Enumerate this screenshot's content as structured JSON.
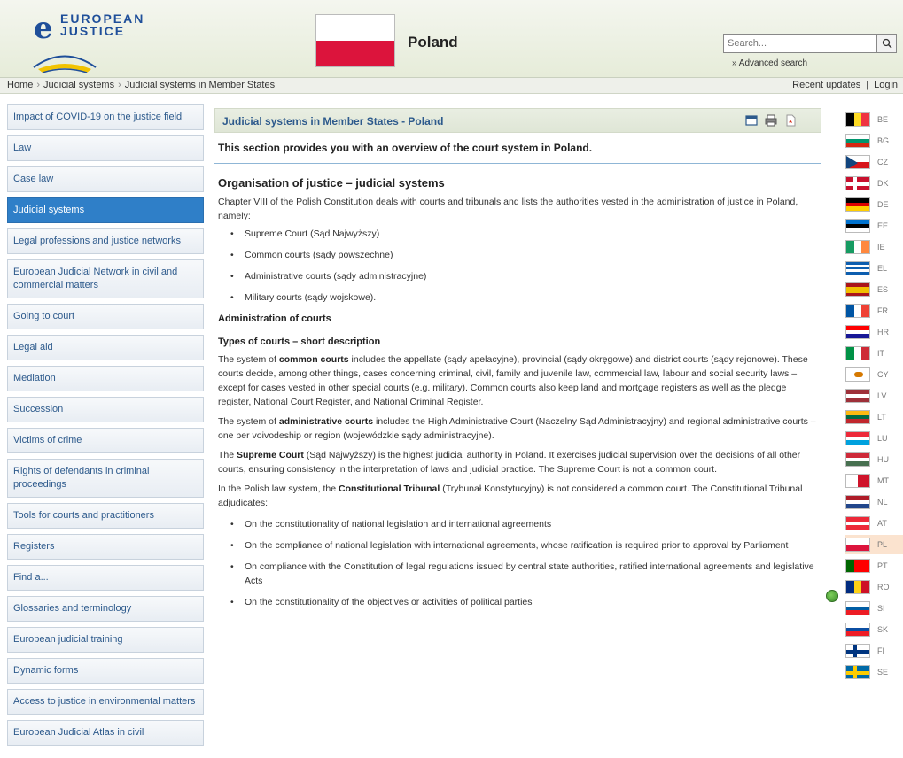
{
  "header": {
    "logo_line1": "EUROPEAN",
    "logo_line2": "JUSTICE",
    "country": "Poland",
    "search_placeholder": "Search...",
    "advanced_search": "» Advanced search"
  },
  "breadcrumb": {
    "items": [
      "Home",
      "Judicial systems",
      "Judicial systems in Member States"
    ],
    "recent_updates": "Recent updates",
    "separator": "|",
    "login": "Login"
  },
  "sidebar": {
    "items": [
      "Impact of COVID-19 on the justice field",
      "Law",
      "Case law",
      "Judicial systems",
      "Legal professions and justice networks",
      "European Judicial Network in civil and commercial matters",
      "Going to court",
      "Legal aid",
      "Mediation",
      "Succession",
      "Victims of crime",
      "Rights of defendants in criminal proceedings",
      "Tools for courts and practitioners",
      "Registers",
      "Find a...",
      "Glossaries and terminology",
      "European judicial training",
      "Dynamic forms",
      "Access to justice in environmental matters",
      "European Judicial Atlas in civil"
    ],
    "active_index": 3
  },
  "content": {
    "title": "Judicial systems in Member States - Poland",
    "intro": "This section provides you with an overview of the court system in Poland.",
    "heading": "Organisation of justice – judicial systems",
    "p1": "Chapter VIII of the Polish Constitution deals with courts and tribunals and lists the authorities vested in the administration of justice in Poland, namely:",
    "list1": [
      "Supreme Court (Sąd Najwyższy)",
      "Common courts (sądy powszechne)",
      "Administrative courts (sądy administracyjne)",
      "Military courts (sądy wojskowe)."
    ],
    "h_admin": "Administration of courts",
    "h_types": "Types of courts – short description",
    "p2_a": "The system of ",
    "p2_b": "common courts",
    "p2_c": " includes the appellate (sądy apelacyjne), provincial (sądy okręgowe) and district courts (sądy rejonowe). These courts decide, among other things, cases concerning criminal, civil, family and juvenile law, commercial law, labour and social security laws – except for cases vested in other special courts (e.g. military). Common courts also keep land and mortgage registers as well as the pledge register, National Court Register, and National Criminal Register.",
    "p3_a": "The system of ",
    "p3_b": "administrative courts",
    "p3_c": " includes the High Administrative Court (Naczelny Sąd Administracyjny) and regional administrative courts – one per voivodeship or region (wojewódzkie sądy administracyjne).",
    "p4_a": "The ",
    "p4_b": "Supreme Court",
    "p4_c": " (Sąd Najwyższy) is the highest judicial authority in Poland. It exercises judicial supervision over the decisions of all other courts, ensuring consistency in the interpretation of laws and judicial practice. The Supreme Court is not a common court.",
    "p5_a": "In the Polish law system, the ",
    "p5_b": "Constitutional Tribunal",
    "p5_c": " (Trybunał Konstytucyjny) is not considered a common court. The Constitutional Tribunal adjudicates:",
    "list2": [
      "On the constitutionality of national legislation and international agreements",
      "On the compliance of national legislation with international agreements, whose ratification is required prior to approval by Parliament",
      "On compliance with the Constitution of legal regulations issued by central state authorities, ratified international agreements and legislative Acts",
      "On the constitutionality of the objectives or activities of political parties"
    ]
  },
  "flags": [
    {
      "code": "BE",
      "dir": "v",
      "colors": [
        "#000000",
        "#fdda24",
        "#ef3340"
      ]
    },
    {
      "code": "BG",
      "dir": "h",
      "colors": [
        "#ffffff",
        "#00966e",
        "#d62612"
      ]
    },
    {
      "code": "CZ",
      "dir": "h",
      "colors": [
        "#ffffff",
        "#d7141a"
      ],
      "triangle": "#11457e"
    },
    {
      "code": "DK",
      "dir": "h",
      "colors": [
        "#c8102e"
      ],
      "cross": "#ffffff"
    },
    {
      "code": "DE",
      "dir": "h",
      "colors": [
        "#000000",
        "#dd0000",
        "#ffce00"
      ]
    },
    {
      "code": "EE",
      "dir": "h",
      "colors": [
        "#0072ce",
        "#000000",
        "#ffffff"
      ]
    },
    {
      "code": "IE",
      "dir": "v",
      "colors": [
        "#169b62",
        "#ffffff",
        "#ff883e"
      ]
    },
    {
      "code": "EL",
      "dir": "h",
      "colors": [
        "#0d5eaf",
        "#ffffff",
        "#0d5eaf",
        "#ffffff",
        "#0d5eaf"
      ]
    },
    {
      "code": "ES",
      "dir": "h",
      "colors": [
        "#aa151b",
        "#f1bf00",
        "#f1bf00",
        "#aa151b"
      ]
    },
    {
      "code": "FR",
      "dir": "v",
      "colors": [
        "#0055a4",
        "#ffffff",
        "#ef4135"
      ]
    },
    {
      "code": "HR",
      "dir": "h",
      "colors": [
        "#ff0000",
        "#ffffff",
        "#171796"
      ]
    },
    {
      "code": "IT",
      "dir": "v",
      "colors": [
        "#009246",
        "#ffffff",
        "#ce2b37"
      ]
    },
    {
      "code": "CY",
      "dir": "h",
      "colors": [
        "#ffffff"
      ],
      "dot": "#d57800"
    },
    {
      "code": "LV",
      "dir": "h",
      "colors": [
        "#9e3039",
        "#ffffff",
        "#9e3039"
      ]
    },
    {
      "code": "LT",
      "dir": "h",
      "colors": [
        "#fdb913",
        "#006a44",
        "#c1272d"
      ]
    },
    {
      "code": "LU",
      "dir": "h",
      "colors": [
        "#ed2939",
        "#ffffff",
        "#00a1de"
      ]
    },
    {
      "code": "HU",
      "dir": "h",
      "colors": [
        "#ce2939",
        "#ffffff",
        "#477050"
      ]
    },
    {
      "code": "MT",
      "dir": "v",
      "colors": [
        "#ffffff",
        "#cf142b"
      ]
    },
    {
      "code": "NL",
      "dir": "h",
      "colors": [
        "#ae1c28",
        "#ffffff",
        "#21468b"
      ]
    },
    {
      "code": "AT",
      "dir": "h",
      "colors": [
        "#ed2939",
        "#ffffff",
        "#ed2939"
      ]
    },
    {
      "code": "PL",
      "dir": "h",
      "colors": [
        "#ffffff",
        "#dc143c"
      ],
      "active": true
    },
    {
      "code": "PT",
      "dir": "v",
      "colors": [
        "#006600",
        "#ff0000",
        "#ff0000"
      ]
    },
    {
      "code": "RO",
      "dir": "v",
      "colors": [
        "#002b7f",
        "#fcd116",
        "#ce1126"
      ]
    },
    {
      "code": "SI",
      "dir": "h",
      "colors": [
        "#ffffff",
        "#005da4",
        "#ed1c24"
      ]
    },
    {
      "code": "SK",
      "dir": "h",
      "colors": [
        "#ffffff",
        "#0b4ea2",
        "#ee1c25"
      ]
    },
    {
      "code": "FI",
      "dir": "h",
      "colors": [
        "#ffffff"
      ],
      "cross": "#003580"
    },
    {
      "code": "SE",
      "dir": "h",
      "colors": [
        "#006aa7"
      ],
      "cross": "#fecc00"
    }
  ]
}
